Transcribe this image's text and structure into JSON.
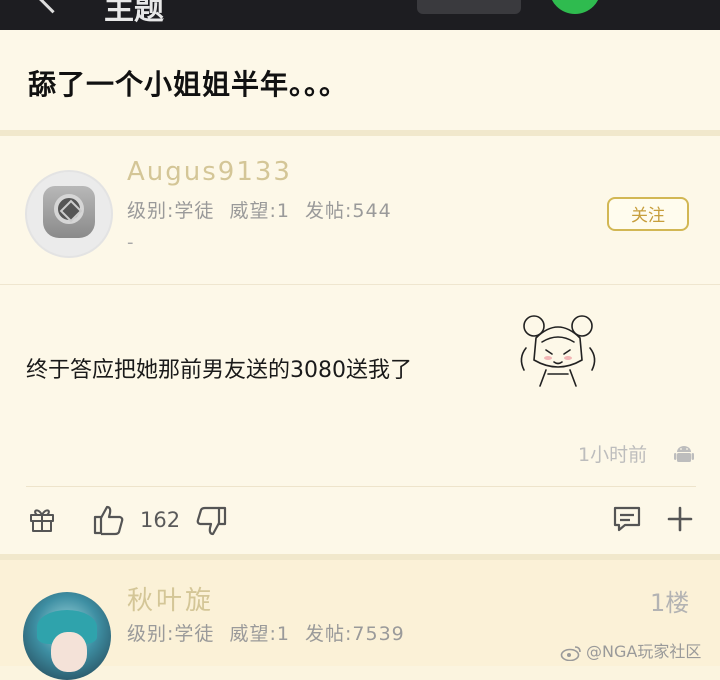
{
  "topbar": {
    "title": "主题"
  },
  "thread": {
    "title": "舔了一个小姐姐半年。。。"
  },
  "post": {
    "author": {
      "username": "Augus9133",
      "level_label": "级别:",
      "level": "学徒",
      "prestige_label": "威望:",
      "prestige": "1",
      "posts_label": "发帖:",
      "posts": "544",
      "signature": "-"
    },
    "follow_label": "关注",
    "content": "终于答应把她那前男友送的3080送我了",
    "time": "1小时前",
    "likes": "162",
    "device_icon": "android-icon"
  },
  "reply": {
    "author": {
      "username": "秋叶旋",
      "level_label": "级别:",
      "level": "学徒",
      "prestige_label": "威望:",
      "prestige": "1",
      "posts_label": "发帖:",
      "posts": "7539"
    },
    "floor": "1楼"
  },
  "watermark": "@NGA玩家社区",
  "colors": {
    "background": "#fbf4df",
    "username": "#d4c697",
    "follow_border": "#d2b754",
    "topbar": "#1d1d21"
  }
}
